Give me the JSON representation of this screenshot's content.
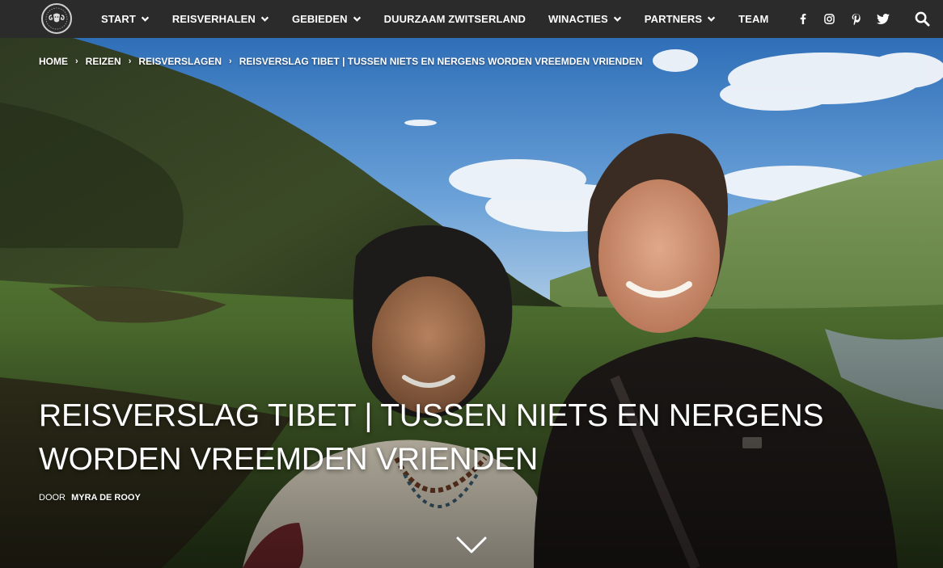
{
  "nav": {
    "logo_icon": "ram-logo-icon",
    "items": [
      {
        "label": "START",
        "dropdown": true
      },
      {
        "label": "REISVERHALEN",
        "dropdown": true
      },
      {
        "label": "GEBIEDEN",
        "dropdown": true
      },
      {
        "label": "DUURZAAM ZWITSERLAND",
        "dropdown": false
      },
      {
        "label": "WINACTIES",
        "dropdown": true
      },
      {
        "label": "PARTNERS",
        "dropdown": true
      },
      {
        "label": "TEAM",
        "dropdown": false
      }
    ],
    "social_icons": [
      "facebook-icon",
      "instagram-icon",
      "pinterest-icon",
      "twitter-icon"
    ],
    "search_icon": "search-icon"
  },
  "breadcrumb": {
    "items": [
      "HOME",
      "REIZEN",
      "REISVERSLAGEN",
      "REISVERSLAG TIBET | TUSSEN NIETS EN NERGENS WORDEN VREEMDEN VRIENDEN"
    ],
    "separator": "›"
  },
  "article": {
    "title": "REISVERSLAG TIBET | TUSSEN NIETS EN NERGENS WORDEN VREEMDEN VRIENDEN",
    "byline_prefix": "DOOR",
    "author": "MYRA DE ROOY"
  },
  "colors": {
    "nav_bg": "#2b2b2b",
    "text": "#ffffff",
    "sky": "#3f7fc6"
  }
}
